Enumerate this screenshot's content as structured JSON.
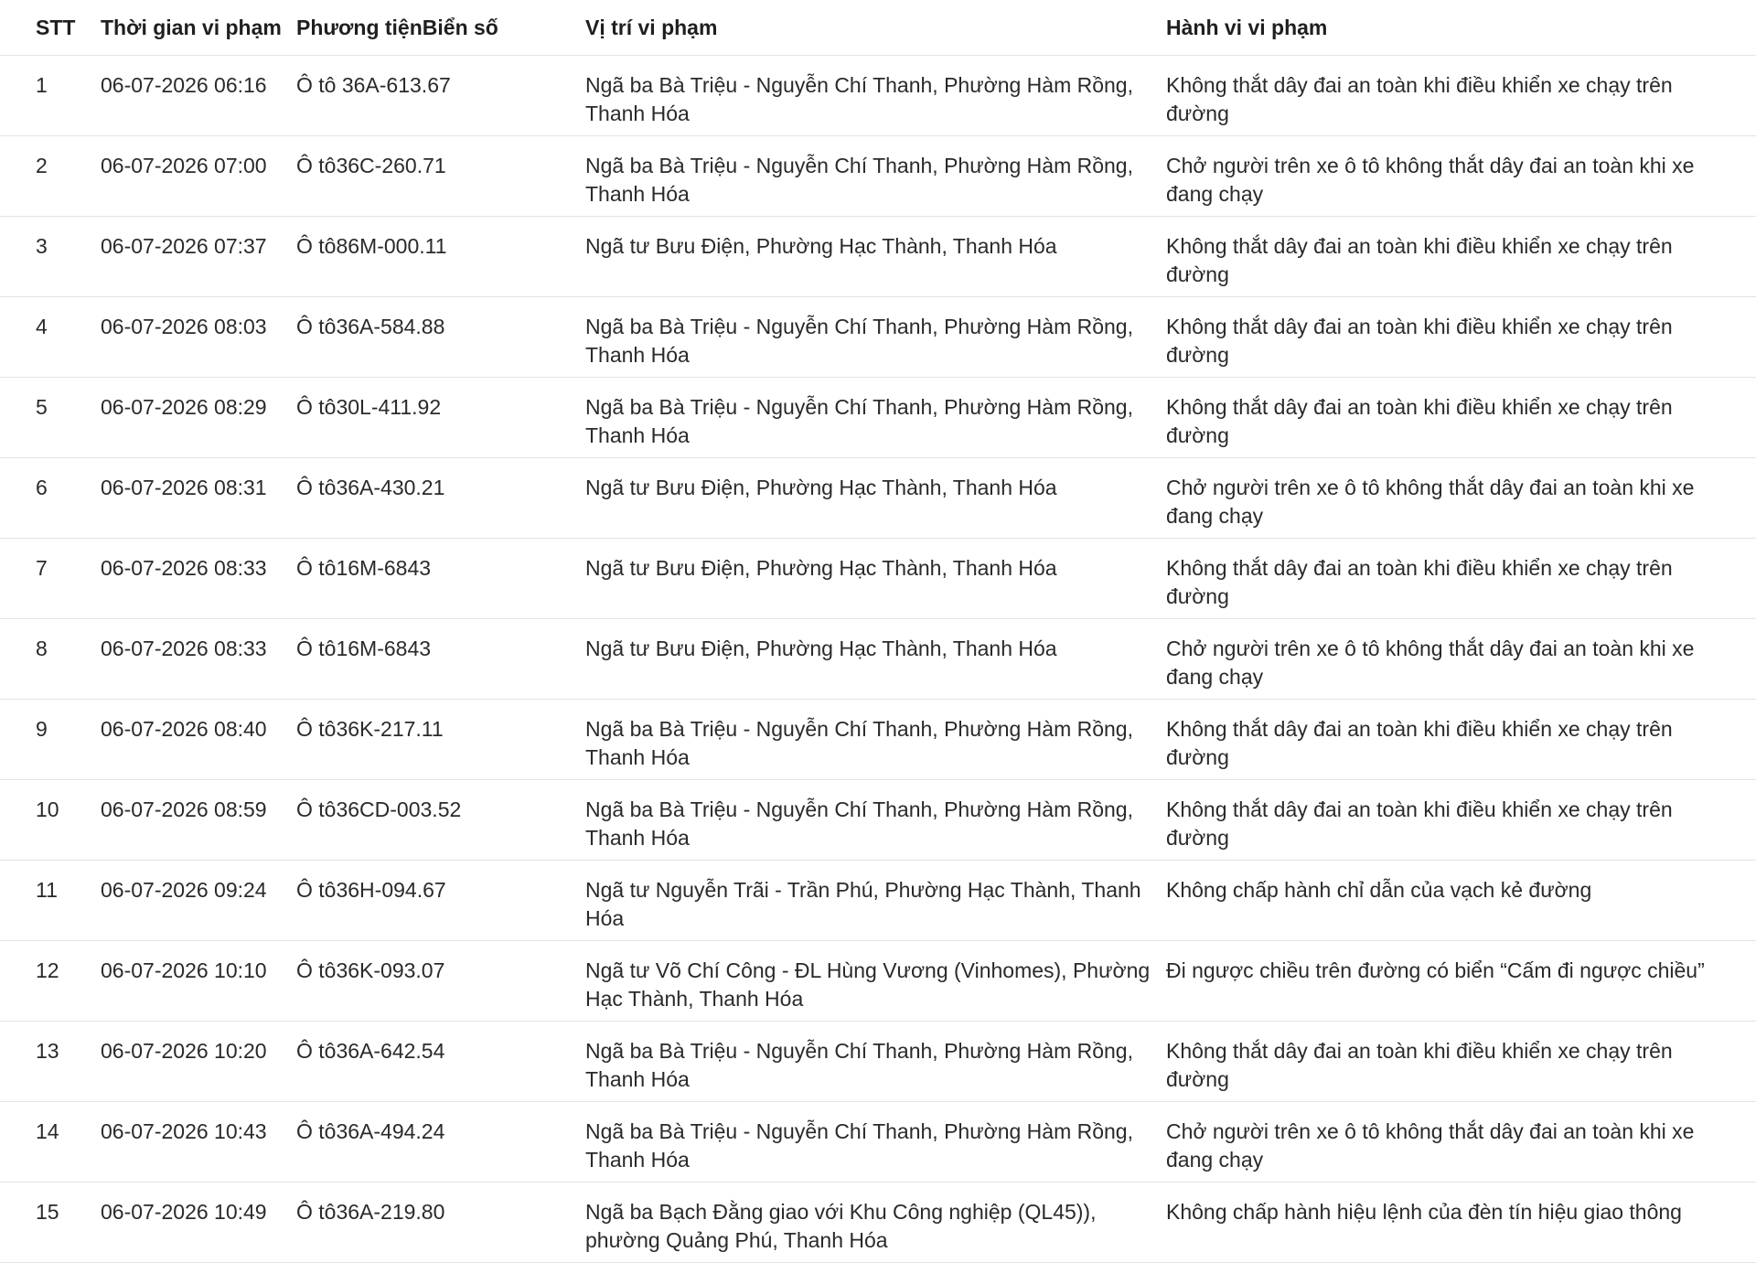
{
  "table": {
    "headers": {
      "stt": "STT",
      "time": "Thời gian vi phạm",
      "vehicle": "Phương tiệnBiển số",
      "location": "Vị trí vi phạm",
      "violation": "Hành vi vi phạm"
    },
    "rows": [
      {
        "stt": "1",
        "time": "06-07-2026 06:16",
        "vehicle": "Ô tô 36A-613.67",
        "location": "Ngã ba Bà Triệu - Nguyễn Chí Thanh, Phường Hàm Rồng, Thanh Hóa",
        "violation": "Không thắt dây đai an toàn khi điều khiển xe chạy trên đường"
      },
      {
        "stt": "2",
        "time": "06-07-2026 07:00",
        "vehicle": "Ô tô36C-260.71",
        "location": "Ngã ba Bà Triệu - Nguyễn Chí Thanh, Phường Hàm Rồng, Thanh Hóa",
        "violation": "Chở người trên xe ô tô không thắt dây đai an toàn khi xe đang chạy"
      },
      {
        "stt": "3",
        "time": "06-07-2026 07:37",
        "vehicle": "Ô tô86M-000.11",
        "location": "Ngã tư Bưu Điện, Phường Hạc Thành, Thanh Hóa",
        "violation": "Không thắt dây đai an toàn khi điều khiển xe chạy trên đường"
      },
      {
        "stt": "4",
        "time": "06-07-2026 08:03",
        "vehicle": "Ô tô36A-584.88",
        "location": "Ngã ba Bà Triệu - Nguyễn Chí Thanh, Phường Hàm Rồng, Thanh Hóa",
        "violation": "Không thắt dây đai an toàn khi điều khiển xe chạy trên đường"
      },
      {
        "stt": "5",
        "time": "06-07-2026 08:29",
        "vehicle": "Ô tô30L-411.92",
        "location": "Ngã ba Bà Triệu - Nguyễn Chí Thanh, Phường Hàm Rồng, Thanh Hóa",
        "violation": "Không thắt dây đai an toàn khi điều khiển xe chạy trên đường"
      },
      {
        "stt": "6",
        "time": "06-07-2026 08:31",
        "vehicle": "Ô tô36A-430.21",
        "location": "Ngã tư Bưu Điện, Phường Hạc Thành, Thanh Hóa",
        "violation": "Chở người trên xe ô tô không thắt dây đai an toàn khi xe đang chạy"
      },
      {
        "stt": "7",
        "time": "06-07-2026 08:33",
        "vehicle": "Ô tô16M-6843",
        "location": "Ngã tư Bưu Điện, Phường Hạc Thành, Thanh Hóa",
        "violation": "Không thắt dây đai an toàn khi điều khiển xe chạy trên đường"
      },
      {
        "stt": "8",
        "time": "06-07-2026 08:33",
        "vehicle": "Ô tô16M-6843",
        "location": "Ngã tư Bưu Điện, Phường Hạc Thành, Thanh Hóa",
        "violation": "Chở người trên xe ô tô không thắt dây đai an toàn khi xe đang chạy"
      },
      {
        "stt": "9",
        "time": "06-07-2026 08:40",
        "vehicle": "Ô tô36K-217.11",
        "location": "Ngã ba Bà Triệu - Nguyễn Chí Thanh, Phường Hàm Rồng, Thanh Hóa",
        "violation": "Không thắt dây đai an toàn khi điều khiển xe chạy trên đường"
      },
      {
        "stt": "10",
        "time": "06-07-2026 08:59",
        "vehicle": "Ô tô36CD-003.52",
        "location": "Ngã ba Bà Triệu - Nguyễn Chí Thanh, Phường Hàm Rồng, Thanh Hóa",
        "violation": "Không thắt dây đai an toàn khi điều khiển xe chạy trên đường"
      },
      {
        "stt": "11",
        "time": "06-07-2026 09:24",
        "vehicle": "Ô tô36H-094.67",
        "location": "Ngã tư Nguyễn Trãi - Trần Phú, Phường Hạc Thành, Thanh Hóa",
        "violation": "Không chấp hành chỉ dẫn của vạch kẻ đường"
      },
      {
        "stt": "12",
        "time": "06-07-2026 10:10",
        "vehicle": "Ô tô36K-093.07",
        "location": "Ngã tư Võ Chí Công - ĐL Hùng Vương (Vinhomes), Phường Hạc Thành, Thanh Hóa",
        "violation": "Đi ngược chiều trên đường có biển “Cấm đi ngược chiều”"
      },
      {
        "stt": "13",
        "time": "06-07-2026 10:20",
        "vehicle": "Ô tô36A-642.54",
        "location": "Ngã ba Bà Triệu - Nguyễn Chí Thanh, Phường Hàm Rồng, Thanh Hóa",
        "violation": "Không thắt dây đai an toàn khi điều khiển xe chạy trên đường"
      },
      {
        "stt": "14",
        "time": "06-07-2026 10:43",
        "vehicle": "Ô tô36A-494.24",
        "location": "Ngã ba Bà Triệu - Nguyễn Chí Thanh, Phường Hàm Rồng, Thanh Hóa",
        "violation": "Chở người trên xe ô tô không thắt dây đai an toàn khi xe đang chạy"
      },
      {
        "stt": "15",
        "time": "06-07-2026 10:49",
        "vehicle": "Ô tô36A-219.80",
        "location": "Ngã ba Bạch Đằng giao với Khu Công nghiệp (QL45)), phường Quảng Phú, Thanh Hóa",
        "violation": "Không chấp hành hiệu lệnh của đèn tín hiệu giao thông"
      }
    ]
  }
}
